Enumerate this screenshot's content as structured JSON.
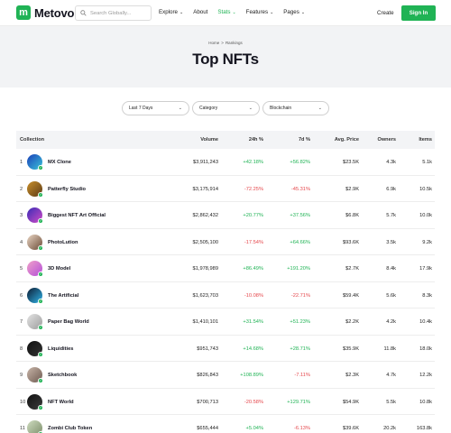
{
  "header": {
    "brand_letter": "m",
    "brand_name": "Metovo",
    "search_placeholder": "Search Globally...",
    "nav": [
      {
        "label": "Explore",
        "dropdown": true
      },
      {
        "label": "About",
        "dropdown": false
      },
      {
        "label": "Stats",
        "dropdown": true,
        "active": true
      },
      {
        "label": "Features",
        "dropdown": true
      },
      {
        "label": "Pages",
        "dropdown": true
      }
    ],
    "create_label": "Create",
    "signin_label": "Sign In"
  },
  "hero": {
    "breadcrumb": [
      "Home",
      "Rankings"
    ],
    "breadcrumb_sep": ">",
    "title": "Top NFTs"
  },
  "filters": [
    {
      "label": "Last 7 Days"
    },
    {
      "label": "Category"
    },
    {
      "label": "Blockchain"
    }
  ],
  "table": {
    "headers": {
      "collection": "Collection",
      "volume": "Volume",
      "change24": "24h %",
      "change7": "7d %",
      "avg_price": "Avg. Price",
      "owners": "Owners",
      "items": "Items"
    },
    "rows": [
      {
        "rank": "1",
        "name": "MX Clone",
        "volume": "$3,911,243",
        "c24": "+42.18%",
        "c7": "+56.82%",
        "avg": "$23.5K",
        "owners": "4.3k",
        "items": "5.1k",
        "colors": [
          "#1b3fb8",
          "#39c4d9"
        ]
      },
      {
        "rank": "2",
        "name": "Patterfly Studio",
        "volume": "$3,175,914",
        "c24": "-72.25%",
        "c7": "-45.31%",
        "avg": "$2.9K",
        "owners": "6.9k",
        "items": "10.5k",
        "colors": [
          "#c98f2a",
          "#5c3b17"
        ]
      },
      {
        "rank": "3",
        "name": "Biggest NFT Art Official",
        "volume": "$2,862,432",
        "c24": "+20.77%",
        "c7": "+37.56%",
        "avg": "$6.8K",
        "owners": "5.7k",
        "items": "10.0k",
        "colors": [
          "#3a2bb5",
          "#d04cc6"
        ]
      },
      {
        "rank": "4",
        "name": "PhotoLution",
        "volume": "$2,505,100",
        "c24": "-17.54%",
        "c7": "+64.66%",
        "avg": "$93.6K",
        "owners": "3.5k",
        "items": "9.2k",
        "colors": [
          "#e9d6c4",
          "#6b4a36"
        ]
      },
      {
        "rank": "5",
        "name": "3D Model",
        "volume": "$1,978,989",
        "c24": "+86.49%",
        "c7": "+191.20%",
        "avg": "$2.7K",
        "owners": "8.4k",
        "items": "17.9k",
        "colors": [
          "#f0a1c9",
          "#b44fd8"
        ]
      },
      {
        "rank": "6",
        "name": "The Artificial",
        "volume": "$1,623,703",
        "c24": "-10.08%",
        "c7": "-22.71%",
        "avg": "$59.4K",
        "owners": "5.6k",
        "items": "8.3k",
        "colors": [
          "#0d1c33",
          "#2fb3e8"
        ]
      },
      {
        "rank": "7",
        "name": "Paper Bag World",
        "volume": "$1,410,101",
        "c24": "+31.54%",
        "c7": "+51.23%",
        "avg": "$2.2K",
        "owners": "4.2k",
        "items": "10.4k",
        "colors": [
          "#e4e4e4",
          "#9c9c9c"
        ]
      },
      {
        "rank": "8",
        "name": "Liquidities",
        "volume": "$951,743",
        "c24": "+14.68%",
        "c7": "+28.71%",
        "avg": "$35.9K",
        "owners": "11.8k",
        "items": "18.0k",
        "colors": [
          "#111111",
          "#333333"
        ]
      },
      {
        "rank": "9",
        "name": "Sketchbook",
        "volume": "$826,843",
        "c24": "+108.89%",
        "c7": "-7.11%",
        "avg": "$2.3K",
        "owners": "4.7k",
        "items": "12.2k",
        "colors": [
          "#c8b5a8",
          "#6e5a51"
        ]
      },
      {
        "rank": "10",
        "name": "NFT World",
        "volume": "$700,713",
        "c24": "-20.58%",
        "c7": "+129.71%",
        "avg": "$54.9K",
        "owners": "5.5k",
        "items": "10.8k",
        "colors": [
          "#121212",
          "#3b3b3b"
        ]
      },
      {
        "rank": "11",
        "name": "Zombi Club Token",
        "volume": "$655,444",
        "c24": "+5.04%",
        "c7": "-6.13%",
        "avg": "$39.6K",
        "owners": "20.2k",
        "items": "163.8k",
        "colors": [
          "#cfdcc0",
          "#7c8e6a"
        ]
      }
    ]
  },
  "colors": {
    "accent": "#20b355",
    "negative": "#e5484d",
    "hero_bg": "#f2f3f5",
    "table_head_bg": "#f3f4f6"
  }
}
